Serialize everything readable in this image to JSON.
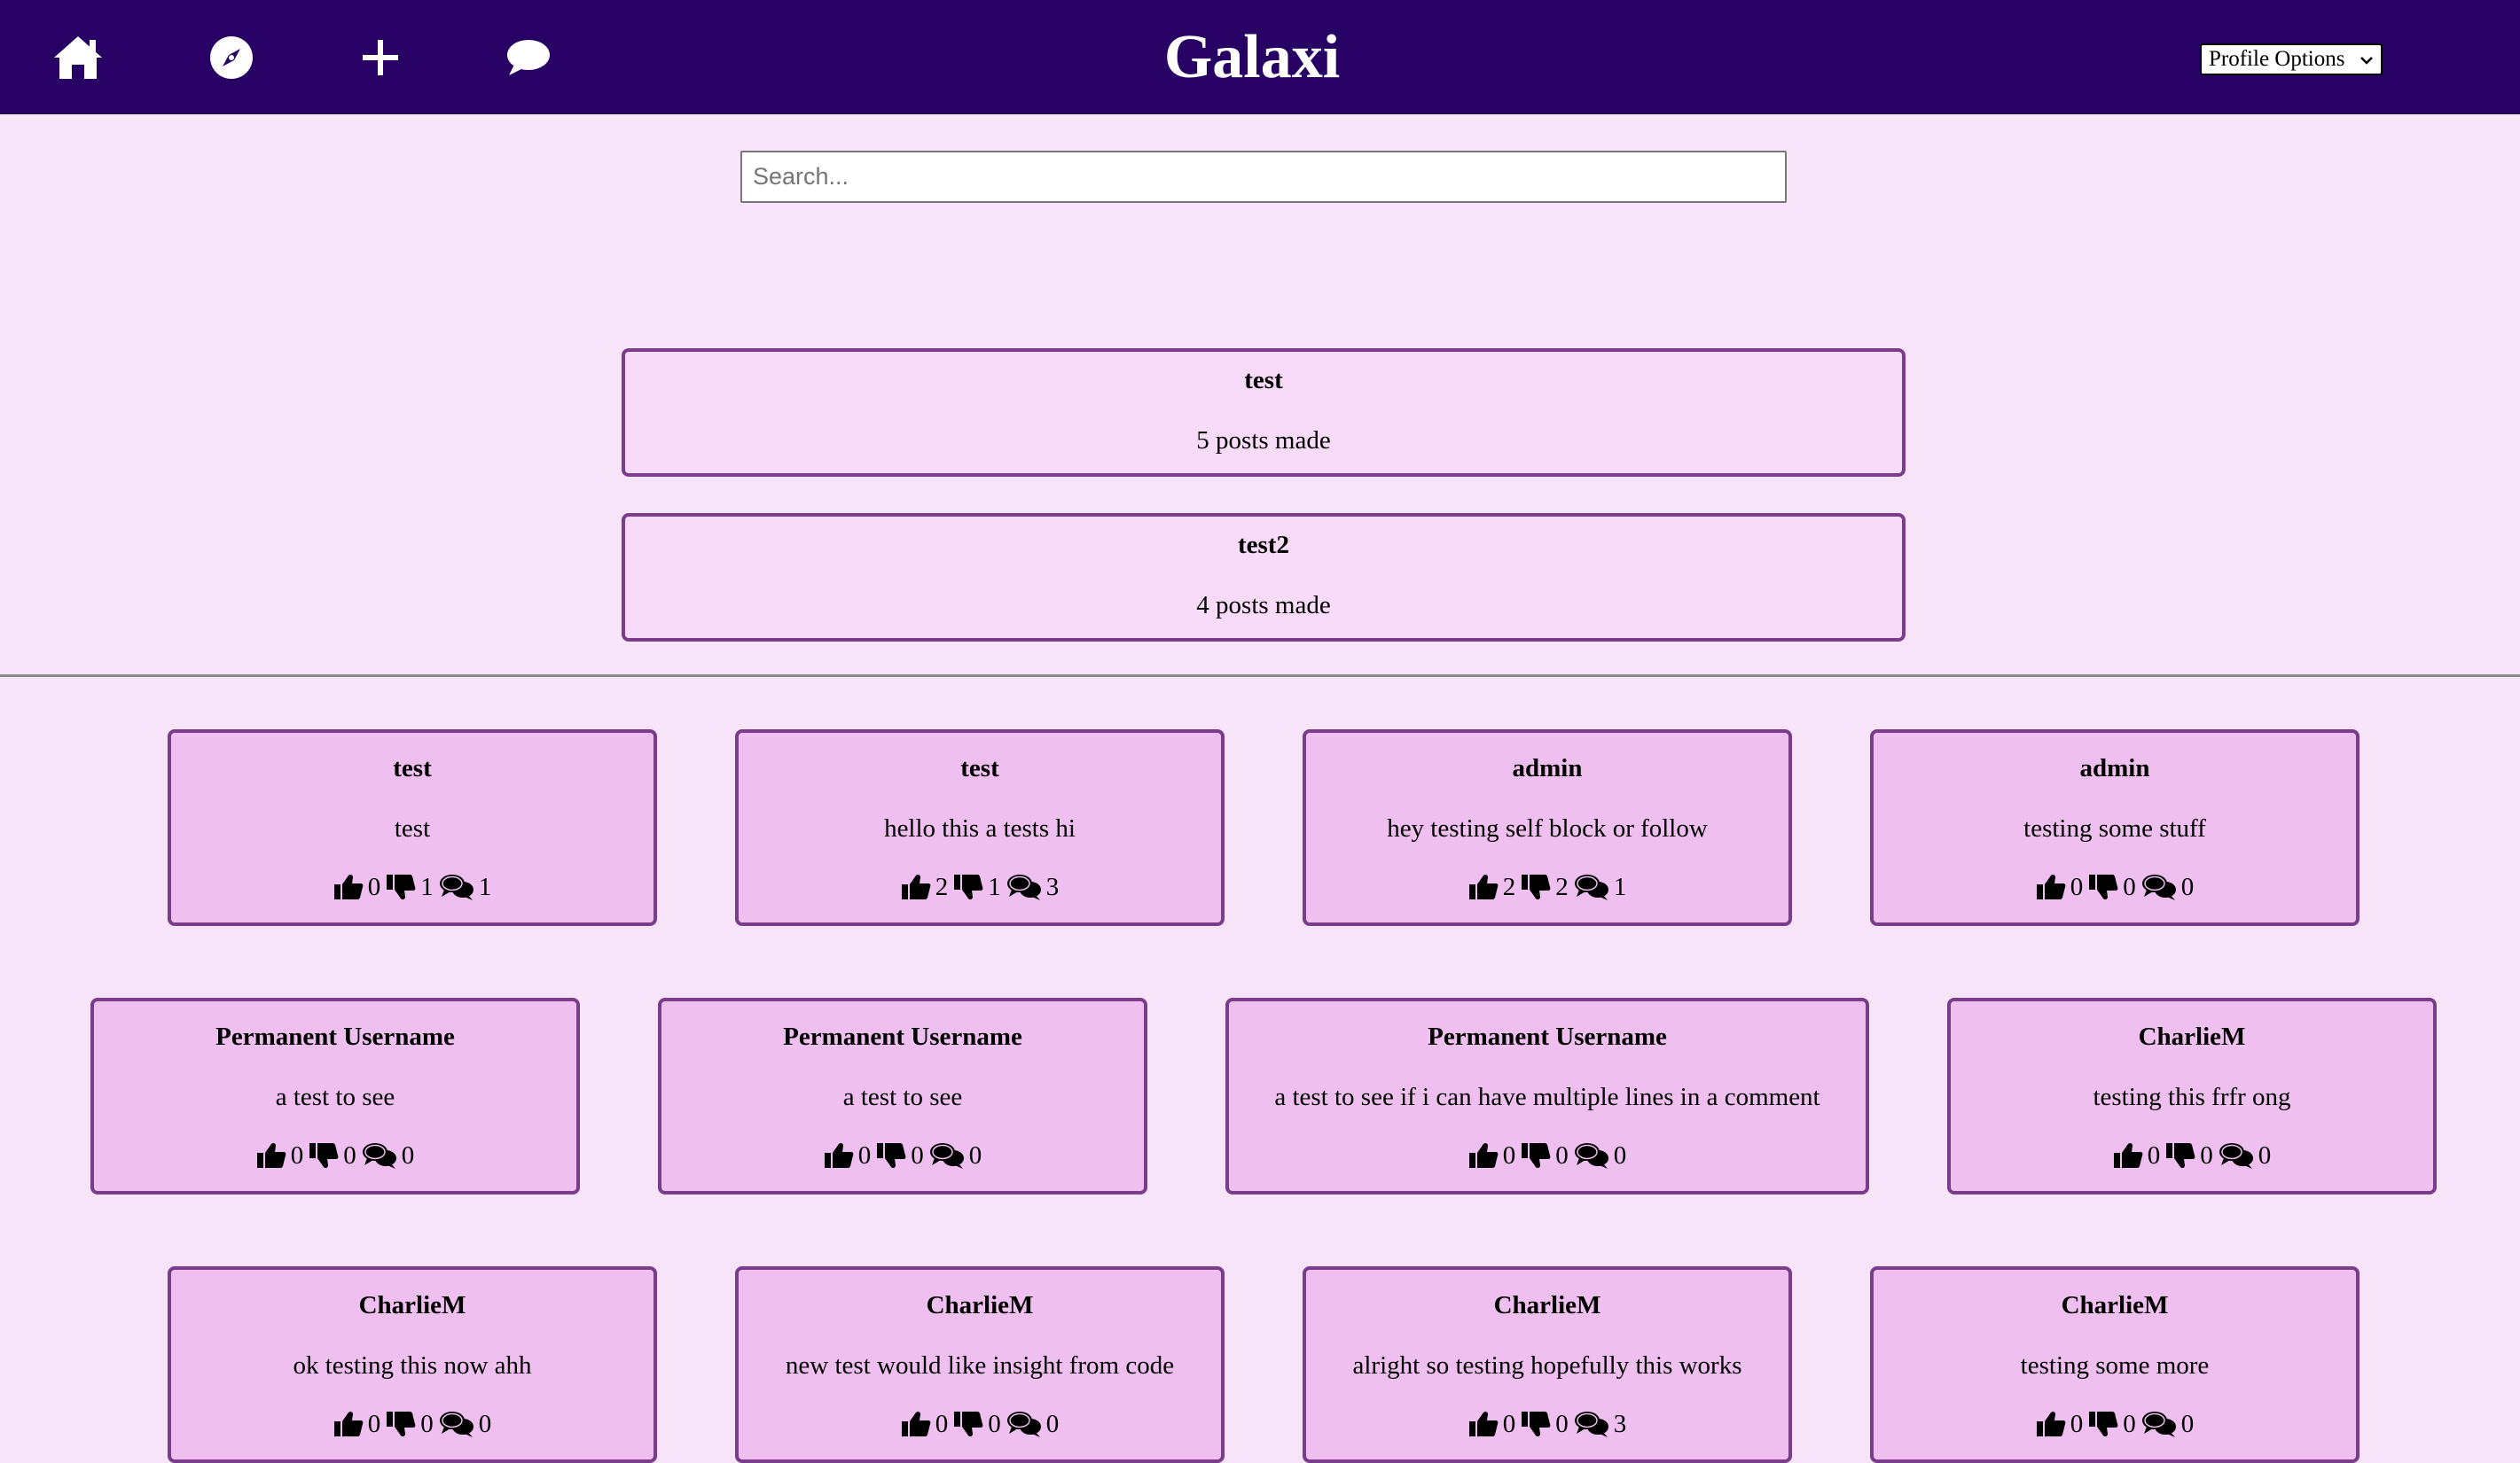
{
  "header": {
    "brand": "Galaxi",
    "nav": [
      {
        "icon": "home-icon"
      },
      {
        "icon": "compass-icon"
      },
      {
        "icon": "plus-icon"
      },
      {
        "icon": "chat-icon"
      }
    ],
    "profile_options_label": "Profile Options",
    "background": "#270264"
  },
  "search": {
    "placeholder": "Search...",
    "value": ""
  },
  "users": [
    {
      "username": "test",
      "posts_label": "5 posts made"
    },
    {
      "username": "test2",
      "posts_label": "4 posts made"
    }
  ],
  "posts": [
    {
      "author": "test",
      "body": "test",
      "likes": "0",
      "dislikes": "1",
      "comments": "1"
    },
    {
      "author": "test",
      "body": "hello this a tests hi",
      "likes": "2",
      "dislikes": "1",
      "comments": "3"
    },
    {
      "author": "admin",
      "body": "hey testing self block or follow",
      "likes": "2",
      "dislikes": "2",
      "comments": "1"
    },
    {
      "author": "admin",
      "body": "testing some stuff",
      "likes": "0",
      "dislikes": "0",
      "comments": "0"
    },
    {
      "author": "Permanent Username",
      "body": "a test to see",
      "likes": "0",
      "dislikes": "0",
      "comments": "0"
    },
    {
      "author": "Permanent Username",
      "body": "a test to see",
      "likes": "0",
      "dislikes": "0",
      "comments": "0"
    },
    {
      "author": "Permanent Username",
      "body": "a test to see if i can have multiple lines in a comment",
      "likes": "0",
      "dislikes": "0",
      "comments": "0"
    },
    {
      "author": "CharlieM",
      "body": "testing this frfr ong",
      "likes": "0",
      "dislikes": "0",
      "comments": "0"
    },
    {
      "author": "CharlieM",
      "body": "ok testing this now ahh",
      "likes": "0",
      "dislikes": "0",
      "comments": "0"
    },
    {
      "author": "CharlieM",
      "body": "new test would like insight from code",
      "likes": "0",
      "dislikes": "0",
      "comments": "0"
    },
    {
      "author": "CharlieM",
      "body": "alright so testing hopefully this works",
      "likes": "0",
      "dislikes": "0",
      "comments": "3"
    },
    {
      "author": "CharlieM",
      "body": "testing some more",
      "likes": "0",
      "dislikes": "0",
      "comments": "0"
    }
  ],
  "colors": {
    "page_background": "#f8e4f8",
    "user_card_background": "#f8dbf8",
    "post_card_background": "#efc0ef",
    "card_border": "#7a3d8c"
  }
}
